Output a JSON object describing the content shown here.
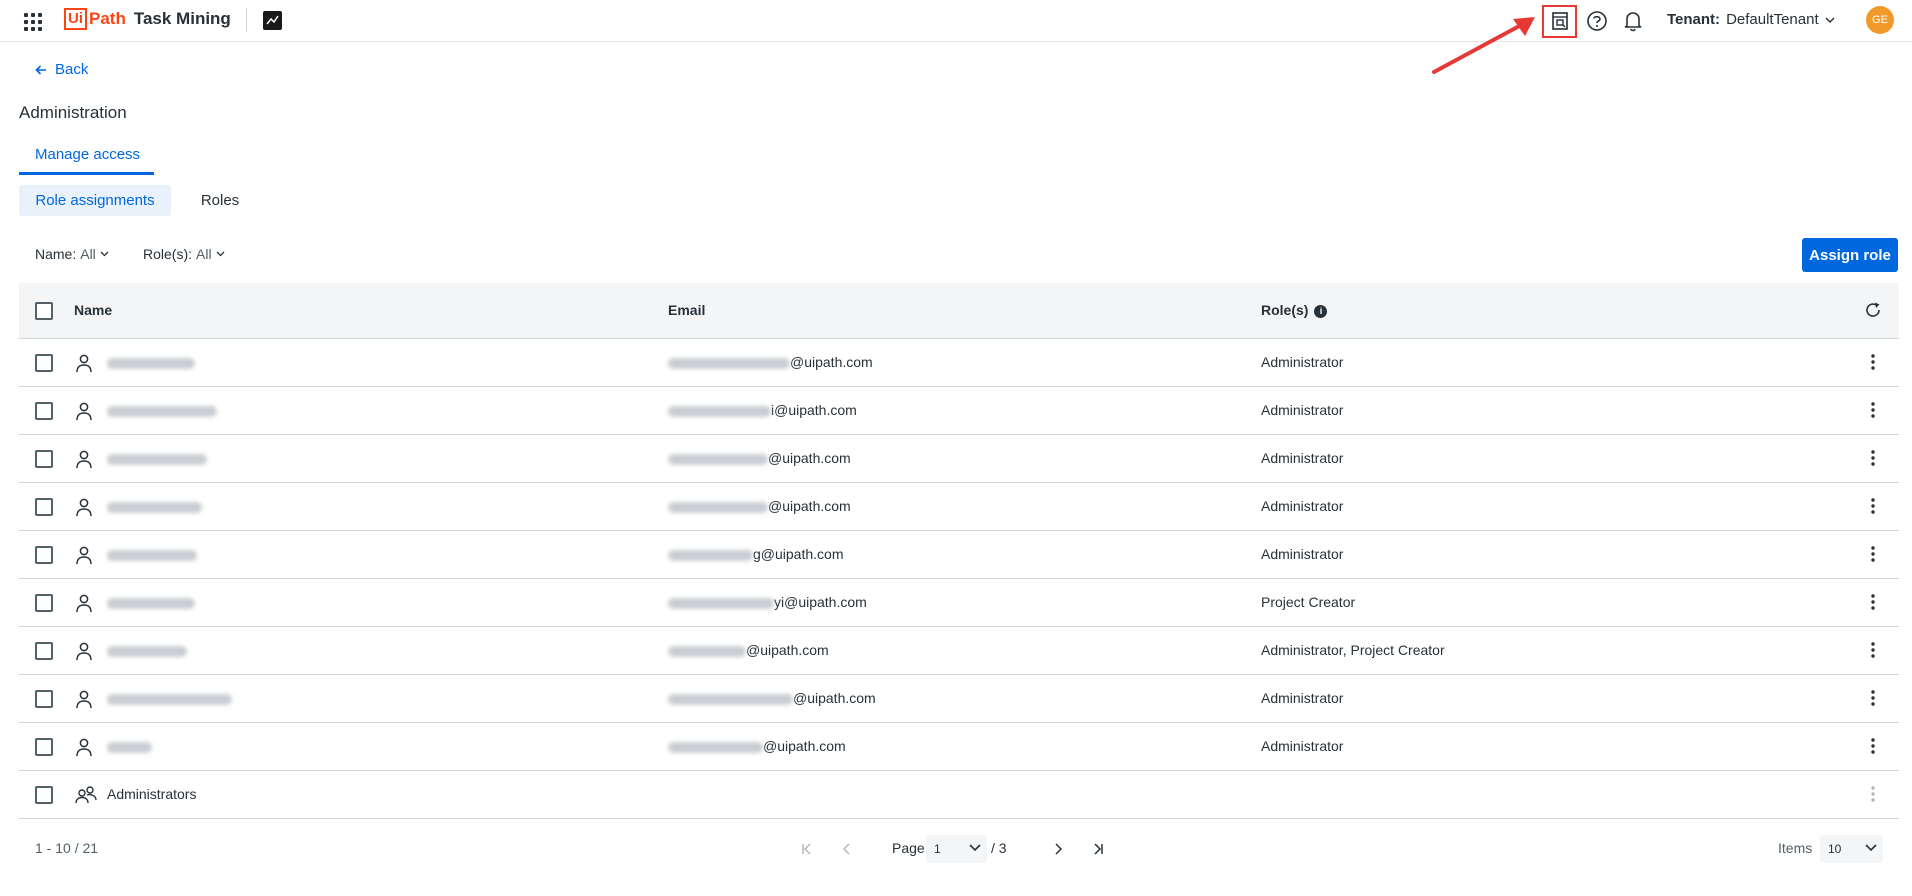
{
  "topbar": {
    "logo_ui": "Ui",
    "logo_path": "Path",
    "product": "Task Mining",
    "tenant_label": "Tenant:",
    "tenant_value": "DefaultTenant",
    "avatar_initials": "GE",
    "icons": [
      "apps-grid-icon",
      "org-building-icon",
      "help-icon",
      "bell-icon",
      "chevron-down-icon"
    ],
    "annotation_color": "#e53935"
  },
  "nav": {
    "back_label": "Back",
    "page_title": "Administration",
    "tab_manage": "Manage access",
    "subtab_role_assignments": "Role assignments",
    "subtab_roles": "Roles"
  },
  "filters": {
    "name_label": "Name:",
    "name_value": "All",
    "roles_label": "Role(s):",
    "roles_value": "All"
  },
  "actions": {
    "assign_role": "Assign role"
  },
  "table": {
    "columns": [
      "Name",
      "Email",
      "Role(s)"
    ],
    "rows": [
      {
        "email_suffix": "@uipath.com",
        "roles": "Administrator"
      },
      {
        "email_suffix": "i@uipath.com",
        "roles": "Administrator"
      },
      {
        "email_suffix": "@uipath.com",
        "roles": "Administrator"
      },
      {
        "email_suffix": "@uipath.com",
        "roles": "Administrator"
      },
      {
        "email_suffix": "g@uipath.com",
        "roles": "Administrator"
      },
      {
        "email_suffix": "yi@uipath.com",
        "roles": "Project Creator"
      },
      {
        "email_suffix": "@uipath.com",
        "roles": "Administrator, Project Creator"
      },
      {
        "email_suffix": "@uipath.com",
        "roles": "Administrator"
      },
      {
        "email_suffix": "@uipath.com",
        "roles": "Administrator"
      }
    ],
    "group_row": {
      "name": "Administrators",
      "email": "",
      "roles": ""
    }
  },
  "pagination": {
    "range": "1 - 10 / 21",
    "page_label": "Page",
    "page_value": "1",
    "page_total": "/ 3",
    "items_label": "Items",
    "items_value": "10"
  },
  "colors": {
    "primary": "#0067df",
    "brand": "#fa4616",
    "text": "#273139",
    "header_bg": "#f4f5f7"
  }
}
